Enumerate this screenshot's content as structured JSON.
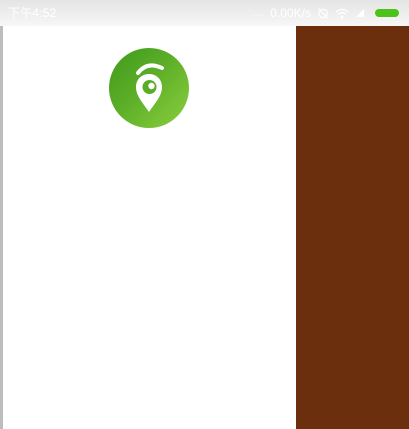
{
  "status_bar": {
    "time": "下午4:52",
    "dots": "...",
    "net_speed": "0.00K/s",
    "icons": [
      "alarm-off-icon",
      "wifi-icon",
      "signal-icon",
      "battery-icon"
    ],
    "battery_color": "#4cc21a"
  },
  "drawer": {
    "logo_icon": "location-pin-icon",
    "logo_colors": [
      "#3e9a1b",
      "#8ccf3e"
    ],
    "background": "#ffffff"
  },
  "main_content": {
    "background": "#6b2f0d"
  }
}
